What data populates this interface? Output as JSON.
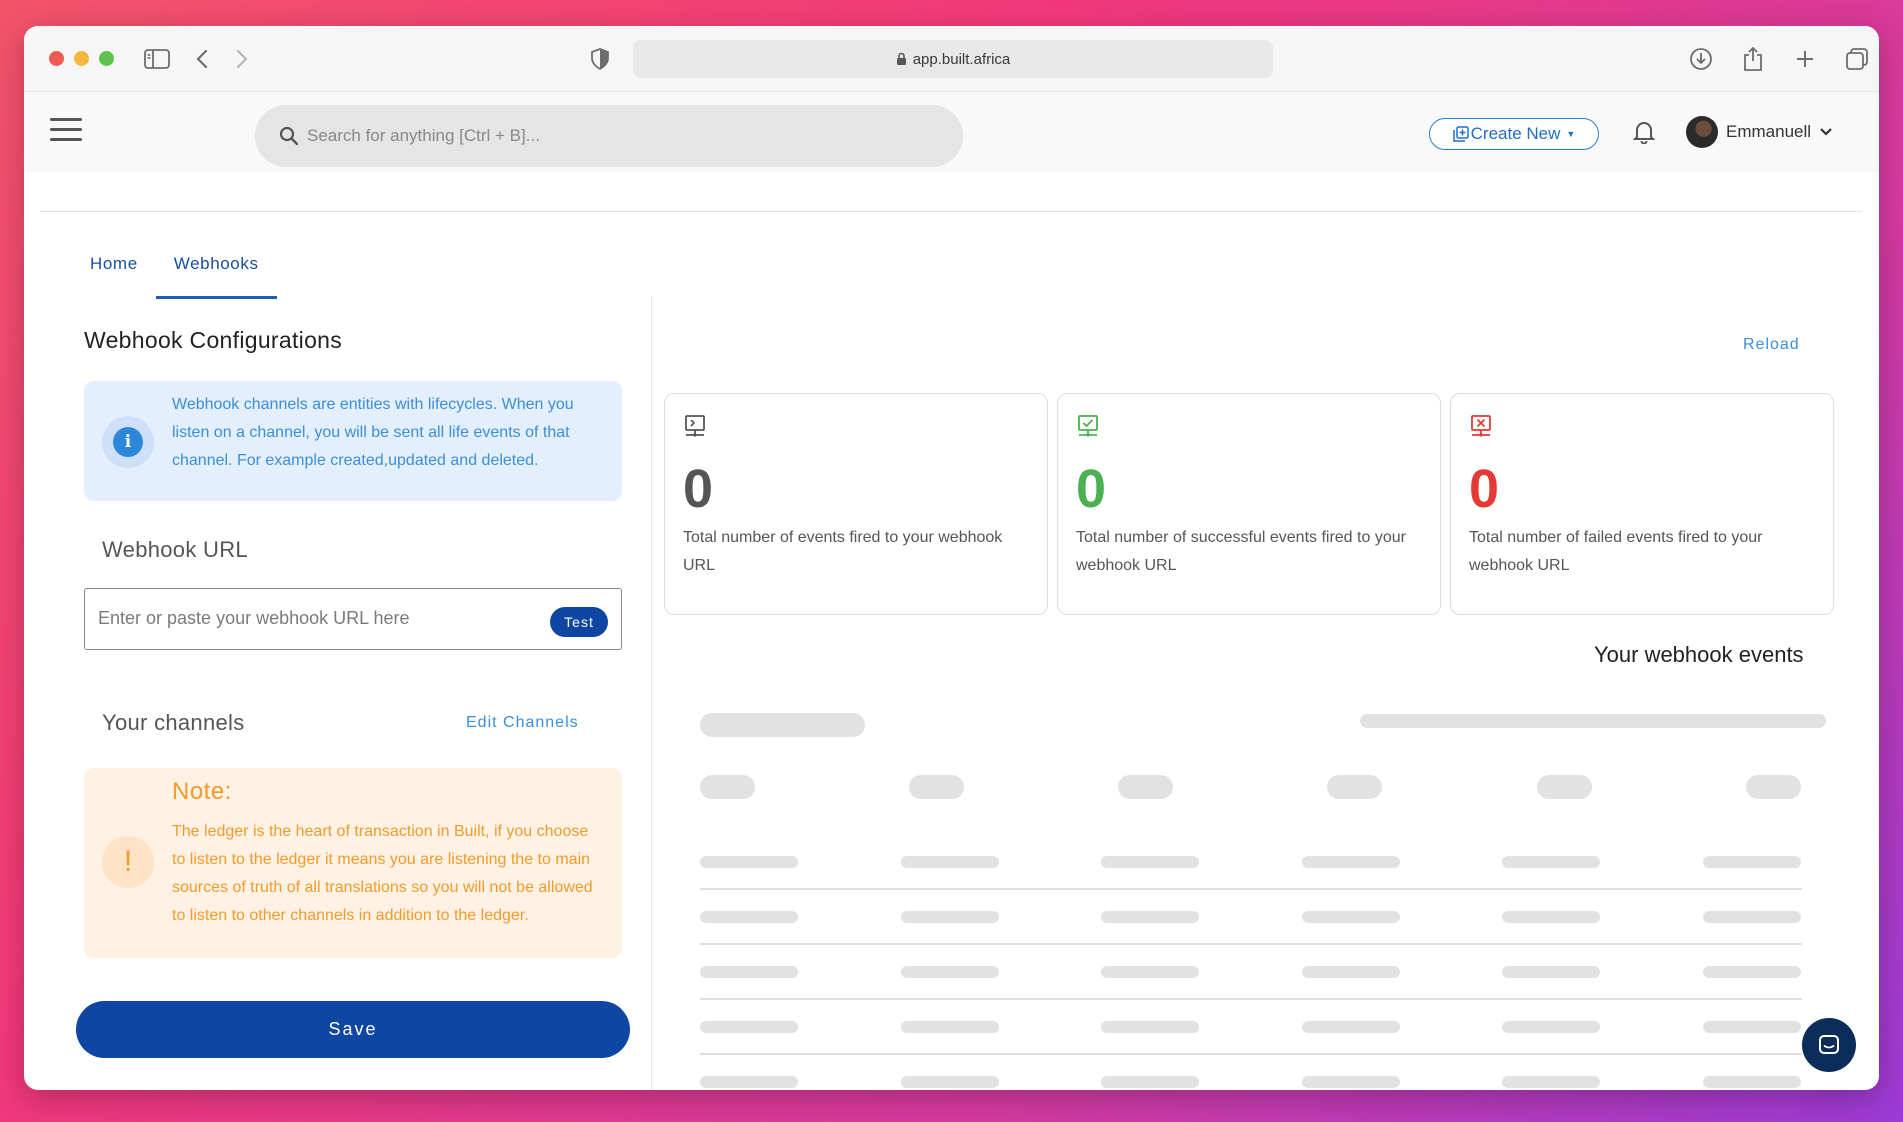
{
  "browser": {
    "url": "app.built.africa"
  },
  "header": {
    "search_placeholder": "Search for anything [Ctrl + B]...",
    "create_label": "Create New",
    "user_name": "Emmanuell"
  },
  "tabs": [
    {
      "label": "Home",
      "active": false
    },
    {
      "label": "Webhooks",
      "active": true
    }
  ],
  "config": {
    "title": "Webhook Configurations",
    "info_text": "Webhook channels are entities with lifecycles. When you listen on a channel, you will be sent all life events of that channel. For example created,updated and deleted.",
    "url_label": "Webhook URL",
    "url_value": "",
    "url_placeholder": "Enter or paste your webhook URL here",
    "test_label": "Test",
    "channels_label": "Your channels",
    "edit_channels_label": "Edit Channels",
    "note_title": "Note:",
    "note_text": "The ledger is the heart of transaction in Built, if you choose to listen to the ledger it means you are listening the to main sources of truth of all translations so you will not be allowed to listen to other channels in addition to the ledger.",
    "save_label": "Save"
  },
  "events": {
    "reload_label": "Reload",
    "title": "Your webhook events",
    "stats": [
      {
        "value": "0",
        "label": "Total number of events fired to your webhook URL",
        "color": "#555555",
        "icon": "monitor-terminal-icon"
      },
      {
        "value": "0",
        "label": "Total number of successful events fired to your webhook URL",
        "color": "#4caf50",
        "icon": "monitor-check-icon"
      },
      {
        "value": "0",
        "label": "Total number of failed events fired to your webhook URL",
        "color": "#e53935",
        "icon": "monitor-error-icon"
      }
    ]
  },
  "colors": {
    "primary": "#0f46a3",
    "link": "#3b8fd6",
    "note": "#f29b2a"
  }
}
